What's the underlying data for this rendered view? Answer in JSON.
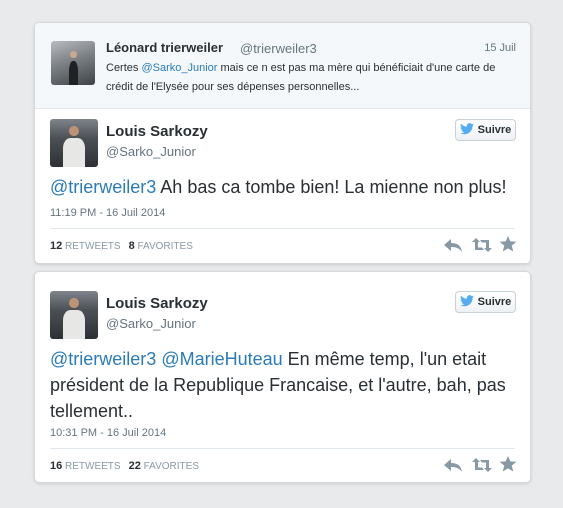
{
  "colors": {
    "link": "#2b7bb9",
    "twitter_blue": "#55acee",
    "icon_gray": "#8899a6"
  },
  "icons": [
    "twitter-bird-icon",
    "reply-icon",
    "retweet-icon",
    "favorite-star-icon"
  ],
  "tweet1": {
    "parent": {
      "name": "Léonard trierweiler",
      "handle": "@trierweiler3",
      "date": "15 Juil",
      "text_before": "Certes ",
      "mention": "@Sarko_Junior",
      "text_after": " mais ce n est pas ma mère qui bénéficiait d'une carte de crédit de l'Elysée pour ses dépenses personnelles..."
    },
    "author": {
      "name": "Louis Sarkozy",
      "handle": "@Sarko_Junior"
    },
    "follow_label": "Suivre",
    "mention": "@trierweiler3",
    "text": " Ah bas ca tombe bien! La mienne non plus!",
    "timestamp": "11:19 PM - 16 Juil 2014",
    "retweets": "12",
    "retweets_label": "RETWEETS",
    "favorites": "8",
    "favorites_label": "FAVORITES"
  },
  "tweet2": {
    "author": {
      "name": "Louis Sarkozy",
      "handle": "@Sarko_Junior"
    },
    "follow_label": "Suivre",
    "mention1": "@trierweiler3",
    "mention2": "@MarieHuteau",
    "text": " En même temp, l'un etait président de la Republique Francaise, et l'autre, bah, pas tellement..",
    "timestamp": "10:31 PM - 16 Juil 2014",
    "retweets": "16",
    "retweets_label": "RETWEETS",
    "favorites": "22",
    "favorites_label": "FAVORITES"
  }
}
